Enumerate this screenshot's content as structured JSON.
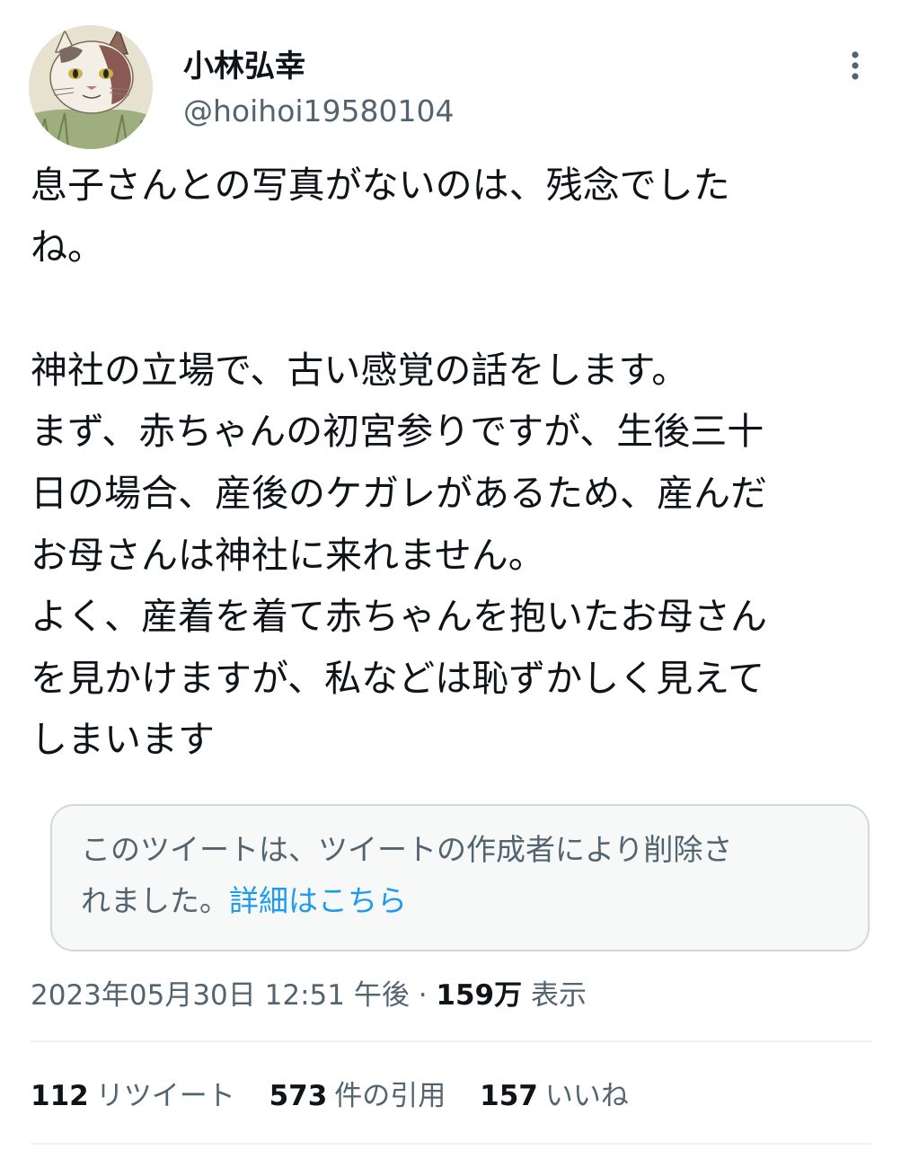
{
  "author": {
    "display_name": "小林弘幸",
    "handle": "@hoihoi19580104",
    "avatar_icon": "cat-illustration-avatar"
  },
  "tweet": {
    "text": "息子さんとの写真がないのは、残念でした\nね。\n\n神社の立場で、古い感覚の話をします。\nまず、赤ちゃんの初宮参りですが、生後三十\n日の場合、産後のケガレがあるため、産んだ\nお母さんは神社に来れません。\nよく、産着を着て赤ちゃんを抱いたお母さん\nを見かけますが、私などは恥ずかしく見えて\nしまいます"
  },
  "quoted": {
    "text": "このツイートは、ツイートの作成者により削除さ\nれました。",
    "link_label": "詳細はこちら"
  },
  "meta": {
    "timestamp": "2023年05月30日 12:51 午後",
    "separator": "·",
    "views_count": "159万",
    "views_label": "表示"
  },
  "stats": {
    "retweets_count": "112",
    "retweets_label": "リツイート",
    "quotes_count": "573",
    "quotes_label": "件の引用",
    "likes_count": "157",
    "likes_label": "いいね"
  },
  "colors": {
    "text_primary": "#0f1419",
    "text_secondary": "#536471",
    "link": "#1d9bf0",
    "card_bg": "#f7f9f9",
    "card_border": "#cfd9de"
  }
}
